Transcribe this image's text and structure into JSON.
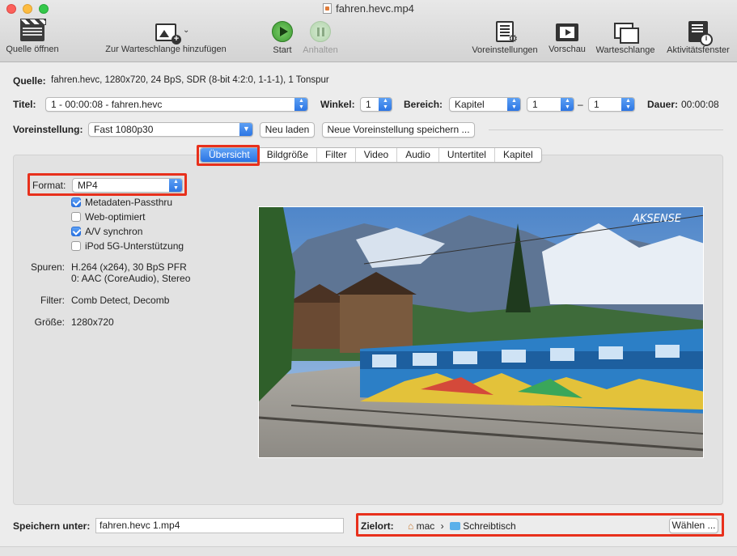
{
  "window": {
    "title": "fahren.hevc.mp4"
  },
  "toolbar": {
    "open_source": "Quelle öffnen",
    "add_queue": "Zur Warteschlange hinzufügen",
    "start": "Start",
    "pause": "Anhalten",
    "presets": "Voreinstellungen",
    "preview": "Vorschau",
    "queue": "Warteschlange",
    "activity": "Aktivitätsfenster"
  },
  "source": {
    "label": "Quelle:",
    "value": "fahren.hevc, 1280x720, 24 BpS, SDR (8-bit 4:2:0, 1-1-1), 1 Tonspur"
  },
  "title_row": {
    "title_label": "Titel:",
    "title_value": "1 - 00:00:08 - fahren.hevc",
    "angle_label": "Winkel:",
    "angle_value": "1",
    "range_label": "Bereich:",
    "range_type": "Kapitel",
    "range_from": "1",
    "range_dash": "–",
    "range_to": "1",
    "duration_label": "Dauer:",
    "duration_value": "00:00:08"
  },
  "preset_row": {
    "label": "Voreinstellung:",
    "value": "Fast 1080p30",
    "reload": "Neu laden",
    "save_new": "Neue Voreinstellung speichern ..."
  },
  "tabs": [
    "Übersicht",
    "Bildgröße",
    "Filter",
    "Video",
    "Audio",
    "Untertitel",
    "Kapitel"
  ],
  "summary": {
    "format_label": "Format:",
    "format_value": "MP4",
    "options": [
      {
        "label": "Metadaten-Passthru",
        "checked": true
      },
      {
        "label": "Web-optimiert",
        "checked": false
      },
      {
        "label": "A/V synchron",
        "checked": true
      },
      {
        "label": "iPod 5G-Unterstützung",
        "checked": false
      }
    ],
    "tracks_label": "Spuren:",
    "tracks_line1": "H.264 (x264), 30 BpS PFR",
    "tracks_line2": "0: AAC (CoreAudio), Stereo",
    "filters_label": "Filter:",
    "filters_value": "Comb Detect, Decomb",
    "size_label": "Größe:",
    "size_value": "1280x720",
    "watermark": "AKSENSE"
  },
  "save": {
    "label": "Speichern unter:",
    "filename": "fahren.hevc 1.mp4",
    "dest_label": "Zielort:",
    "path_home": "mac",
    "path_sep": "›",
    "path_folder": "Schreibtisch",
    "choose": "Wählen ..."
  },
  "colors": {
    "accent": "#2a73e3",
    "highlight": "#e8301c"
  }
}
